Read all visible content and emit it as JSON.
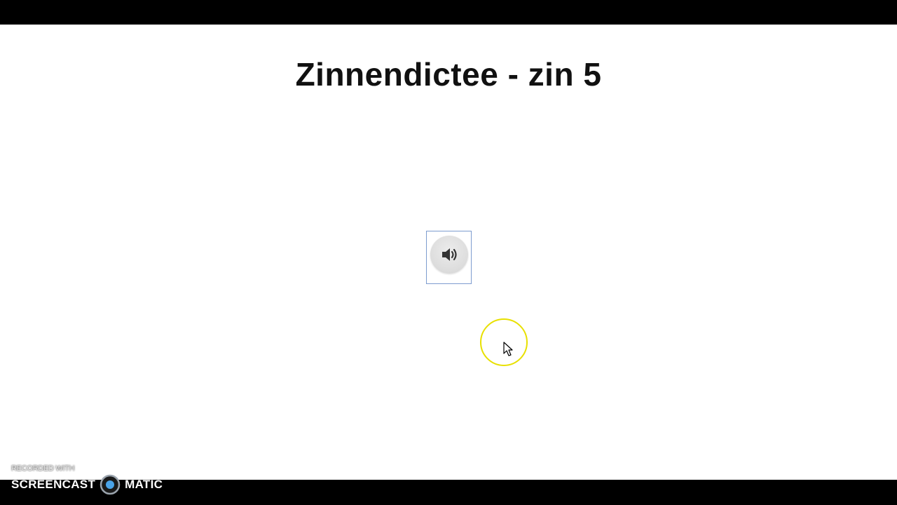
{
  "slide": {
    "title": "Zinnendictee - zin 5"
  },
  "audio": {
    "icon": "speaker-volume-icon"
  },
  "watermark": {
    "recorded_with": "RECORDED WITH",
    "brand_left": "SCREENCAST",
    "brand_right": "MATIC"
  },
  "colors": {
    "cursor_highlight": "#e8e000",
    "audio_border": "#7d9ccf"
  }
}
